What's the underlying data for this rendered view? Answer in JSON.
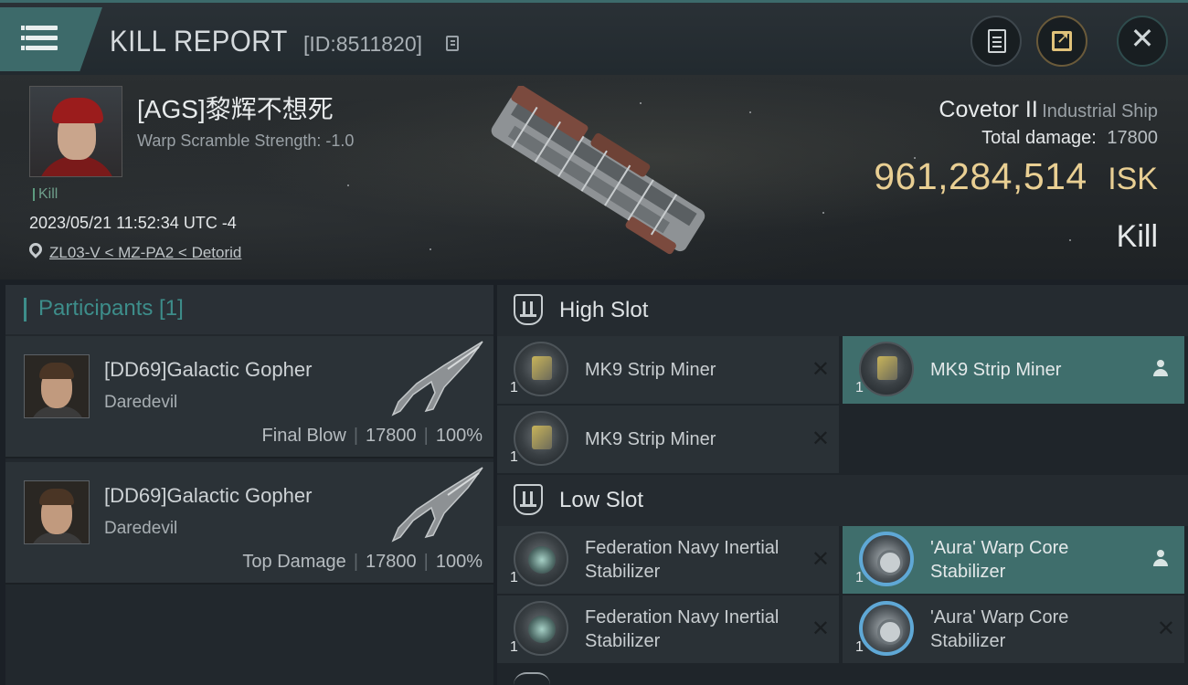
{
  "header": {
    "title": "KILL REPORT",
    "report_id": "[ID:8511820]"
  },
  "victim": {
    "name": "[AGS]黎辉不想死",
    "warp_scramble": "Warp Scramble Strength: -1.0",
    "tag": "Kill",
    "timestamp": "2023/05/21 11:52:34 UTC -4",
    "location": "ZL03-V < MZ-PA2 < Detorid",
    "ship_name": "Covetor II",
    "ship_class": "Industrial Ship",
    "total_damage_label": "Total damage:",
    "total_damage": "17800",
    "isk_value": "961,284,514",
    "isk_unit": "ISK",
    "result": "Kill"
  },
  "participants": {
    "header": "Participants [1]",
    "items": [
      {
        "name": "[DD69]Galactic Gopher",
        "ship": "Daredevil",
        "role": "Final Blow",
        "damage": "17800",
        "percent": "100%"
      },
      {
        "name": "[DD69]Galactic Gopher",
        "ship": "Daredevil",
        "role": "Top Damage",
        "damage": "17800",
        "percent": "100%"
      }
    ]
  },
  "fitting": {
    "high_slot": {
      "title": "High Slot",
      "modules": [
        {
          "name": "MK9 Strip Miner",
          "qty": "1",
          "state": "destroyed"
        },
        {
          "name": "MK9 Strip Miner",
          "qty": "1",
          "state": "dropped"
        },
        {
          "name": "MK9 Strip Miner",
          "qty": "1",
          "state": "destroyed"
        }
      ]
    },
    "low_slot": {
      "title": "Low Slot",
      "modules": [
        {
          "name": "Federation Navy Inertial Stabilizer",
          "qty": "1",
          "state": "destroyed"
        },
        {
          "name": "'Aura' Warp Core Stabilizer",
          "qty": "1",
          "state": "dropped"
        },
        {
          "name": "Federation Navy Inertial Stabilizer",
          "qty": "1",
          "state": "destroyed"
        },
        {
          "name": "'Aura' Warp Core Stabilizer",
          "qty": "1",
          "state": "destroyed"
        }
      ]
    }
  },
  "colors": {
    "accent": "#3d8d8a",
    "isk": "#e9cf93",
    "highlight": "#3f6e6c"
  },
  "icons": {
    "menu": "hamburger-icon",
    "copy": "copy-icon",
    "clipboard": "clipboard-icon",
    "share": "share-icon",
    "close": "close-icon",
    "location": "pin-icon",
    "slot": "slot-icon",
    "destroyed": "x-icon",
    "dropped": "person-icon"
  }
}
